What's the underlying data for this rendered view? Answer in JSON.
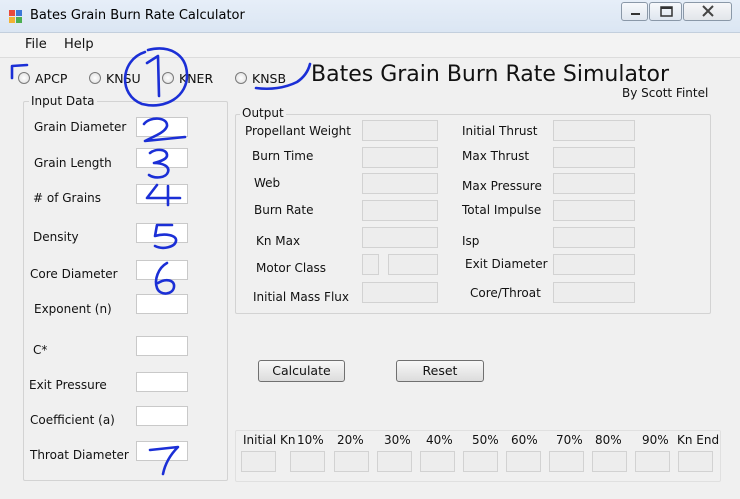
{
  "window": {
    "title": "Bates Grain Burn Rate Calculator"
  },
  "menu": {
    "file": "File",
    "help": "Help"
  },
  "propellants": [
    {
      "label": "APCP",
      "selected": false
    },
    {
      "label": "KNSU",
      "selected": false
    },
    {
      "label": "KNER",
      "selected": false
    },
    {
      "label": "KNSB",
      "selected": false
    }
  ],
  "header": {
    "title": "Bates Grain Burn Rate Simulator",
    "author": "By Scott Fintel"
  },
  "input": {
    "group_title": "Input Data",
    "labels": {
      "grain_diameter": "Grain Diameter",
      "grain_length": "Grain Length",
      "num_grains": "# of Grains",
      "density": "Density",
      "core_diameter": "Core Diameter",
      "exponent": "Exponent (n)",
      "c_star": "C*",
      "exit_pressure": "Exit Pressure",
      "coefficient": "Coefficient (a)",
      "throat_diameter": "Throat Diameter"
    }
  },
  "output": {
    "group_title": "Output",
    "labels": {
      "propellant_weight": "Propellant Weight",
      "burn_time": "Burn Time",
      "web": "Web",
      "burn_rate": "Burn Rate",
      "kn_max": "Kn Max",
      "motor_class": "Motor Class",
      "initial_mass_flux": "Initial Mass Flux",
      "initial_thrust": "Initial Thrust",
      "max_thrust": "Max Thrust",
      "max_pressure": "Max Pressure",
      "total_impulse": "Total Impulse",
      "isp": "Isp",
      "exit_diameter": "Exit Diameter",
      "core_throat": "Core/Throat"
    }
  },
  "buttons": {
    "calculate": "Calculate",
    "reset": "Reset"
  },
  "kn_table": {
    "headers": [
      "Initial Kn",
      "10%",
      "20%",
      "30%",
      "40%",
      "50%",
      "60%",
      "70%",
      "80%",
      "90%",
      "Kn End"
    ]
  },
  "annotations": {
    "ink_color": "#1b2fd6"
  }
}
